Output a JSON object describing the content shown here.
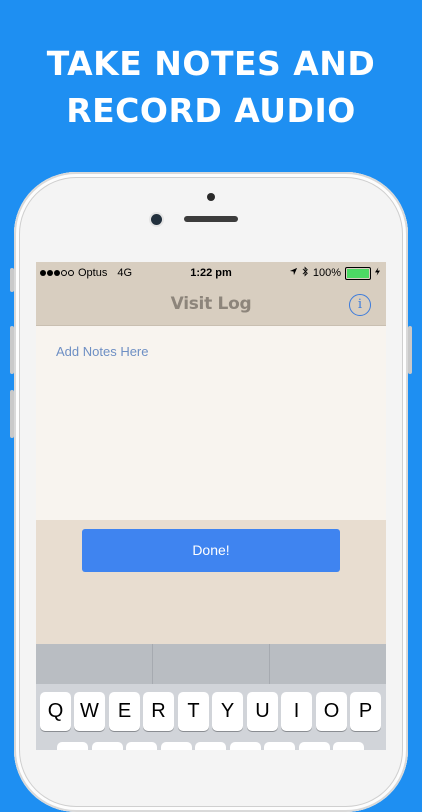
{
  "headline": {
    "line1": "TAKE NOTES AND",
    "line2": "RECORD AUDIO"
  },
  "status_bar": {
    "carrier": "Optus",
    "network": "4G",
    "time": "1:22 pm",
    "battery": "100%",
    "signal_bars_filled": 3,
    "signal_bars_total": 5
  },
  "nav": {
    "title": "Visit Log",
    "info_icon": "info-icon"
  },
  "notes": {
    "placeholder": "Add Notes Here"
  },
  "actions": {
    "done_label": "Done!"
  },
  "keyboard": {
    "row1": [
      "Q",
      "W",
      "E",
      "R",
      "T",
      "Y",
      "U",
      "I",
      "O",
      "P"
    ]
  },
  "colors": {
    "background": "#1e8ff2",
    "accent": "#3f84f0",
    "bar": "#d8cec0"
  }
}
